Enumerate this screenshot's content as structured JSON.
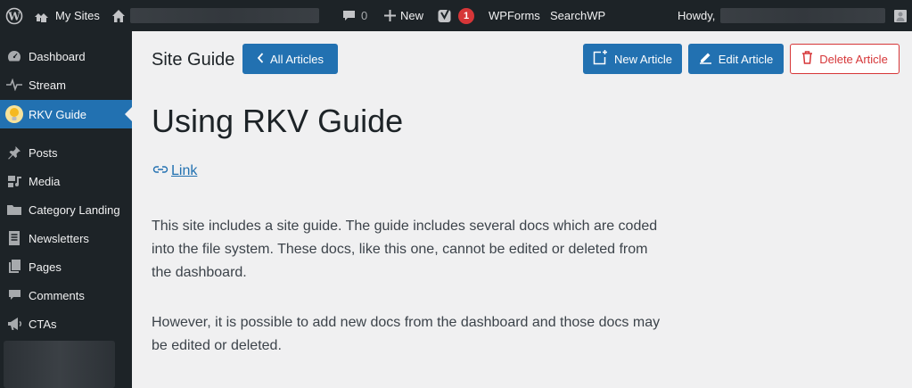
{
  "admin_bar": {
    "my_sites_label": "My Sites",
    "comments_count": "0",
    "new_label": "New",
    "yoast_badge": "1",
    "wpforms_label": "WPForms",
    "searchwp_label": "SearchWP",
    "howdy_label": "Howdy,"
  },
  "sidebar": {
    "items": [
      {
        "label": "Dashboard",
        "icon": "dashboard-icon"
      },
      {
        "label": "Stream",
        "icon": "stream-icon"
      },
      {
        "label": "RKV Guide",
        "icon": "lightbulb-icon"
      },
      {
        "label": "Posts",
        "icon": "pin-icon"
      },
      {
        "label": "Media",
        "icon": "media-icon"
      },
      {
        "label": "Category Landing",
        "icon": "folder-icon"
      },
      {
        "label": "Newsletters",
        "icon": "document-icon"
      },
      {
        "label": "Pages",
        "icon": "pages-icon"
      },
      {
        "label": "Comments",
        "icon": "comment-icon"
      },
      {
        "label": "CTAs",
        "icon": "megaphone-icon"
      }
    ],
    "active": "RKV Guide"
  },
  "header": {
    "section_title": "Site Guide",
    "all_articles_label": "All Articles",
    "new_article_label": "New Article",
    "edit_article_label": "Edit Article",
    "delete_article_label": "Delete Article"
  },
  "article": {
    "title": "Using RKV Guide",
    "link_label": "Link",
    "paragraphs": [
      "This site includes a site guide. The guide includes several docs which are coded into the file system. These docs, like this one, cannot be edited or deleted from the dashboard.",
      "However, it is possible to add new docs from the dashboard and those docs may be edited or deleted."
    ]
  },
  "colors": {
    "admin_bg": "#1d2327",
    "accent": "#2271b1",
    "danger": "#d63638",
    "content_bg": "#f0f0f1"
  }
}
